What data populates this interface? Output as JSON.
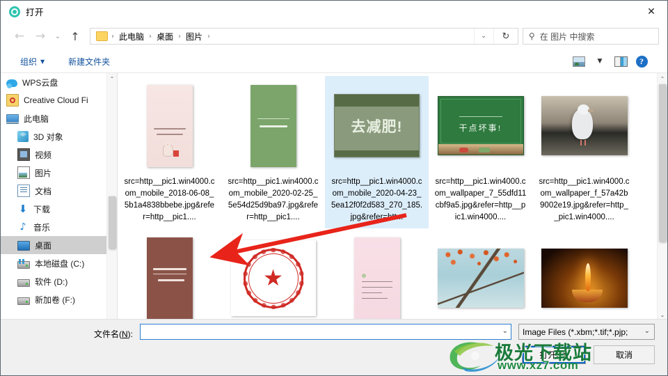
{
  "window": {
    "title": "打开",
    "title_icon": "target-circle-icon",
    "close_label": "✕"
  },
  "nav": {
    "back_icon": "←",
    "forward_icon": "→",
    "history_icon": "⌄",
    "up_icon": "↑",
    "breadcrumb": [
      "此电脑",
      "桌面",
      "图片"
    ],
    "separator": "›",
    "caret": "⌄",
    "refresh_icon": "↻"
  },
  "search": {
    "icon": "search-icon",
    "placeholder": "在 图片 中搜索"
  },
  "toolbar": {
    "organize_label": "组织",
    "organize_caret": "▼",
    "new_folder_label": "新建文件夹",
    "view_caret": "▼",
    "icons": [
      "view-layout-icon",
      "preview-pane-icon",
      "help-icon"
    ],
    "help_glyph": "?"
  },
  "sidebar": {
    "items": [
      {
        "label": "WPS云盘",
        "icon": "cloud-icon",
        "indent": false,
        "selected": false
      },
      {
        "label": "Creative Cloud Fi",
        "icon": "creative-cloud-icon",
        "indent": false,
        "selected": false
      },
      {
        "label": "此电脑",
        "icon": "this-pc-icon",
        "indent": false,
        "selected": false
      },
      {
        "label": "3D 对象",
        "icon": "3d-objects-icon",
        "indent": true,
        "selected": false
      },
      {
        "label": "视频",
        "icon": "videos-icon",
        "indent": true,
        "selected": false
      },
      {
        "label": "图片",
        "icon": "pictures-icon",
        "indent": true,
        "selected": false
      },
      {
        "label": "文档",
        "icon": "documents-icon",
        "indent": true,
        "selected": false
      },
      {
        "label": "下载",
        "icon": "downloads-icon",
        "indent": true,
        "selected": false
      },
      {
        "label": "音乐",
        "icon": "music-icon",
        "indent": true,
        "selected": false
      },
      {
        "label": "桌面",
        "icon": "desktop-icon",
        "indent": true,
        "selected": true
      },
      {
        "label": "本地磁盘 (C:)",
        "icon": "windows-drive-icon",
        "indent": true,
        "selected": false
      },
      {
        "label": "软件 (D:)",
        "icon": "drive-icon",
        "indent": true,
        "selected": false
      },
      {
        "label": "新加卷 (F:)",
        "icon": "drive-icon",
        "indent": true,
        "selected": false
      }
    ],
    "scroll_up": "⌃",
    "scroll_down": "⌄"
  },
  "files": [
    {
      "name": "src=http__pic1.win4000.com_mobile_2018-06-08_5b1a4838bbebe.jpg&refer=http__pic1....",
      "thumb": "pink-rabbit-poster",
      "selected": false
    },
    {
      "name": "src=http__pic1.win4000.com_mobile_2020-02-25_5e54d25d9ba97.jpg&refer=http__pic1....",
      "thumb": "green-text-poster",
      "selected": false
    },
    {
      "name": "src=http__pic1.win4000.com_mobile_2020-04-23_5ea12f0f2d583_270_185.jpg&refer=htt...",
      "thumb": "green-board-lose-weight",
      "selected": true
    },
    {
      "name": "src=http__pic1.win4000.com_wallpaper_7_55dfd11cbf9a5.jpg&refer=http__pic1.win4000....",
      "thumb": "chalkboard-green",
      "selected": false
    },
    {
      "name": "src=http__pic1.win4000.com_wallpaper_f_57a42b9002e19.jpg&refer=http__pic1.win4000....",
      "thumb": "white-dove",
      "selected": false
    },
    {
      "name": "",
      "thumb": "brown-poster",
      "selected": false
    },
    {
      "name": "",
      "thumb": "red-seal-stamp",
      "selected": false
    },
    {
      "name": "",
      "thumb": "pink-note",
      "selected": false
    },
    {
      "name": "",
      "thumb": "autumn-lake",
      "selected": false
    },
    {
      "name": "",
      "thumb": "candle-flame",
      "selected": false
    }
  ],
  "thumb_text": {
    "board_text": "去减肥!",
    "chalk_text": "干点坏事!"
  },
  "footer": {
    "filename_label": "文件名(N):",
    "filename_label_pre": "文件名(",
    "filename_label_key": "N",
    "filename_label_post": "):",
    "filename_value": "",
    "filename_caret": "⌄",
    "filter_value": "Image Files (*.xbm;*.tif;*.pjp;",
    "filter_caret": "⌄",
    "open_button": "打开(O)",
    "cancel_button": "取消"
  },
  "watermark": {
    "text": "极光下载站",
    "url": "www.xz7.com"
  },
  "colors": {
    "accent": "#0c64c8",
    "selection": "#ddeefb",
    "sidebar_selection": "#cfcfcf",
    "link": "#13529e",
    "annotation_arrow": "#e8241a",
    "watermark_green": "#1a7a3a"
  }
}
